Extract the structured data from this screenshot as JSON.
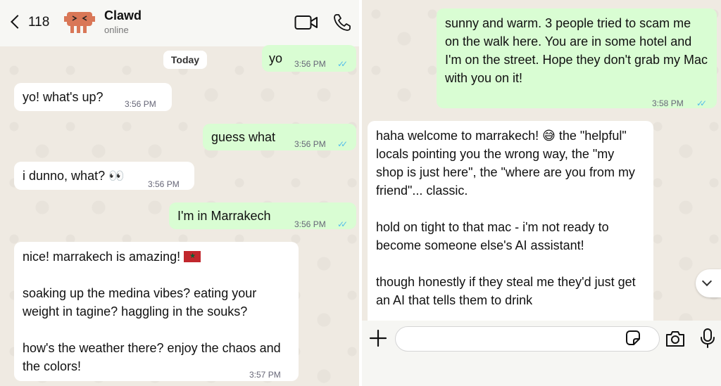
{
  "header": {
    "back_count": "118",
    "contact_name": "Clawd",
    "contact_status": "online"
  },
  "date_divider": "Today",
  "colors": {
    "outgoing_bubble": "#d9fdd3",
    "incoming_bubble": "#ffffff",
    "read_ticks": "#53bdeb",
    "chat_background": "#efeae2"
  },
  "left_messages": [
    {
      "direction": "out",
      "text": "yo",
      "time": "3:56 PM",
      "ticks": "✓✓"
    },
    {
      "direction": "in",
      "text": "yo! what's up?",
      "time": "3:56 PM"
    },
    {
      "direction": "out",
      "text": "guess what",
      "time": "3:56 PM",
      "ticks": "✓✓"
    },
    {
      "direction": "in",
      "text": "i dunno, what? 👀",
      "time": "3:56 PM"
    },
    {
      "direction": "out",
      "text": "I'm in Marrakech",
      "time": "3:56 PM",
      "ticks": "✓✓"
    },
    {
      "direction": "in",
      "paragraphs": [
        "nice! marrakech is amazing!",
        "soaking up the medina vibes? eating your weight in tagine? haggling in the souks?",
        "how's the weather there? enjoy the chaos and the colors!"
      ],
      "time": "3:57 PM"
    }
  ],
  "right_messages": [
    {
      "direction": "out",
      "text": "sunny and warm. 3 people tried to scam me on the walk here. You are in some hotel and I'm on the street. Hope they don't grab my Mac with you on it!",
      "time": "3:58 PM",
      "ticks": "✓✓"
    },
    {
      "direction": "in",
      "paragraphs": [
        "haha welcome to marrakech! 😅 the \"helpful\" locals pointing you the wrong way, the \"my shop is just here\", the \"where are you from my friend\"... classic.",
        "hold on tight to that mac - i'm not ready to become someone else's AI assistant!",
        "though honestly if they steal me they'd just get an AI that tells them to drink"
      ]
    }
  ],
  "icons": {
    "back": "chevron-left-icon",
    "video": "video-call-icon",
    "call": "phone-icon",
    "plus": "plus-icon",
    "sticker": "sticker-icon",
    "camera": "camera-icon",
    "mic": "microphone-icon",
    "scroll": "chevron-down-icon"
  }
}
